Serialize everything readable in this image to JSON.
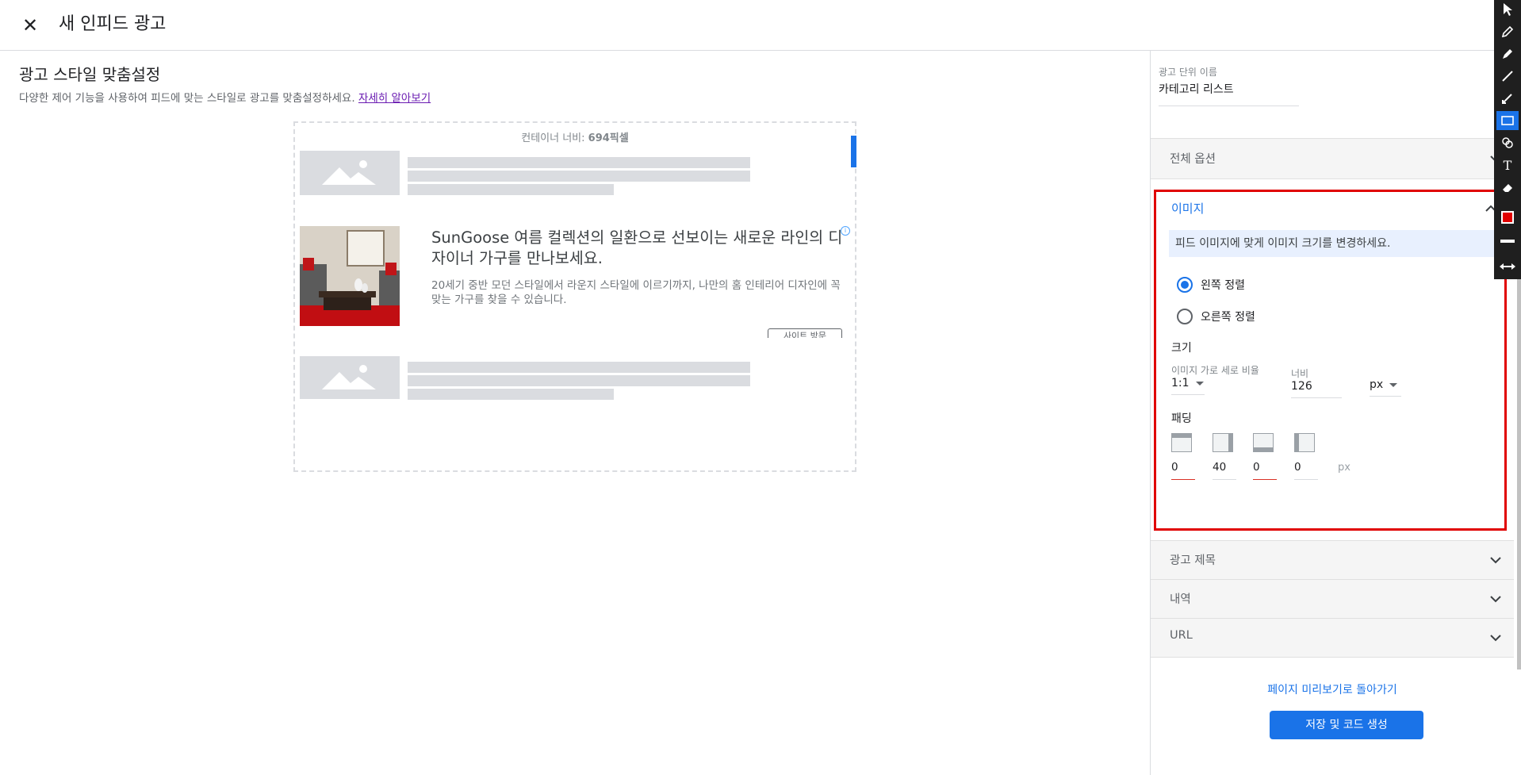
{
  "header": {
    "close_icon": "close-icon",
    "title": "새 인피드 광고"
  },
  "main": {
    "title": "광고 스타일 맞춤설정",
    "description": "다양한 제어 기능을 사용하여 피드에 맞는 스타일로 광고를 맞춤설정하세요.",
    "learn_more": "자세히 알아보기",
    "preview": {
      "container_label": "컨테이너 너비:",
      "container_value": "694픽셀",
      "ad_title": "SunGoose 여름 컬렉션의 일환으로 선보이는 새로운 라인의 디자이너 가구를 만나보세요.",
      "ad_body": "20세기 중반 모던 스타일에서 라운지 스타일에 이르기까지, 나만의 홈 인테리어 디자인에 꼭 맞는 가구를 찾을 수 있습니다.",
      "ad_cta": "사이트 방문"
    }
  },
  "panel": {
    "unit_name_label": "광고 단위 이름",
    "unit_name_value": "카테고리 리스트",
    "sections": {
      "all_options": "전체 옵션",
      "image": "이미지",
      "ad_title": "광고 제목",
      "description": "내역",
      "url": "URL"
    },
    "image": {
      "info": "피드 이미지에 맞게 이미지 크기를 변경하세요.",
      "align_left": "왼쪽 정렬",
      "align_right": "오른쪽 정렬",
      "selected_alignment": "left",
      "size_title": "크기",
      "ratio_label": "이미지 가로 세로 비율",
      "ratio_value": "1:1",
      "width_label": "너비",
      "width_value": "126",
      "unit_value": "px",
      "padding_title": "패딩",
      "padding_top": "0",
      "padding_right": "40",
      "padding_bottom": "0",
      "padding_left": "0",
      "padding_unit": "px"
    },
    "back_link": "페이지 미리보기로 돌아가기",
    "save_button": "저장 및 코드 생성"
  },
  "toolbar": {
    "tools": [
      "pointer-icon",
      "pencil-icon",
      "marker-icon",
      "line-icon",
      "arrow-icon",
      "rectangle-icon",
      "ellipse-icon",
      "text-icon",
      "eraser-icon",
      "color-swatch-icon",
      "stroke-width-icon",
      "resize-icon"
    ],
    "active_tool": "rectangle-icon",
    "active_color": "#e00000"
  },
  "colors": {
    "accent": "#1a73e8",
    "highlight": "#e00000"
  }
}
